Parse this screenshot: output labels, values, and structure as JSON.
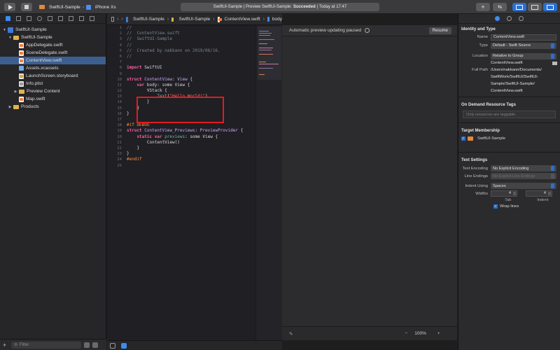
{
  "toolbar": {
    "scheme": "SwiftUI-Sample",
    "device": "iPhone Xs",
    "status_prefix": "SwiftUI-Sample | Preview SwiftUI-Sample:",
    "status_state": "Succeeded",
    "status_time": "| Today at 17:47"
  },
  "navigator": {
    "items": [
      {
        "label": "SwiftUI-Sample",
        "icon": "project-icon"
      },
      {
        "label": "SwiftUI-Sample",
        "icon": "folder-icon"
      },
      {
        "label": "AppDelegate.swift",
        "icon": "swift-file-icon"
      },
      {
        "label": "SceneDelegate.swift",
        "icon": "swift-file-icon"
      },
      {
        "label": "ContentView.swift",
        "icon": "swift-file-icon"
      },
      {
        "label": "Assets.xcassets",
        "icon": "assets-icon"
      },
      {
        "label": "LaunchScreen.storyboard",
        "icon": "storyboard-icon"
      },
      {
        "label": "Info.plist",
        "icon": "plist-icon"
      },
      {
        "label": "Preview Content",
        "icon": "folder-icon"
      },
      {
        "label": "Map.swift",
        "icon": "swift-file-icon"
      },
      {
        "label": "Products",
        "icon": "folder-icon"
      }
    ],
    "filter_placeholder": "Filter"
  },
  "jumpbar": {
    "crumbs": [
      "SwiftUI-Sample",
      "SwiftUI-Sample",
      "ContentView.swift",
      "body"
    ]
  },
  "editor": {
    "line_numbers": [
      "1",
      "2",
      "3",
      "4",
      "5",
      "6",
      "7",
      "8",
      "9",
      "10",
      "11",
      "12",
      "13",
      "14",
      "15",
      "16",
      "17",
      "18",
      "19",
      "20",
      "21",
      "22",
      "23",
      "24",
      "25"
    ],
    "lines": {
      "l1": "//",
      "l2": "//  ContentView.swift",
      "l3": "//  SwiftUI-Sample",
      "l4": "//",
      "l5": "//  Created by nakkann on 2019/08/16.",
      "l6": "//",
      "l8_kw": "import",
      "l8_rest": " SwiftUI",
      "l10_kw": "struct",
      "l10_ty": " ContentView",
      "l10_rest": ": ",
      "l10_ty2": "View",
      "l10_end": " {",
      "l11_kw": "    var",
      "l11_rest": " body: some View {",
      "l12": "        VStack {",
      "l13_fn": "            Text",
      "l13_p1": "(",
      "l13_st": "\"Hello World!\"",
      "l13_p2": ")",
      "l14": "        }",
      "l15": "    }",
      "l16": "}",
      "l18": "#if DEBUG",
      "l19_kw": "struct",
      "l19_ty": " ContentView_Previews",
      "l19_rest": ": ",
      "l19_ty2": "PreviewProvider",
      "l19_end": " {",
      "l20_kw": "    static var",
      "l20_fn": " previews",
      "l20_rest": ": some View {",
      "l21": "        ContentView()",
      "l22": "    }",
      "l23": "}",
      "l24": "#endif"
    }
  },
  "canvas": {
    "notice": "Automatic preview updating paused",
    "resume": "Resume",
    "zoom": "100%"
  },
  "inspector": {
    "identity_title": "Identity and Type",
    "name_label": "Name",
    "name_value": "ContentView.swift",
    "type_label": "Type",
    "type_value": "Default - Swift Source",
    "location_label": "Location",
    "location_value": "Relative to Group",
    "location_file": "ContentView.swift",
    "fullpath_label": "Full Path",
    "fullpath_value_1": "/Users/nakkann/Documents/",
    "fullpath_value_2": "SwiftWork/SwiftUI/SwiftUI-",
    "fullpath_value_3": "Sample/SwiftUI-Sample/",
    "fullpath_value_4": "ContentView.swift",
    "odr_title": "On Demand Resource Tags",
    "odr_placeholder": "Only resources are taggable",
    "target_title": "Target Membership",
    "target_name": "SwiftUI-Sample",
    "text_title": "Text Settings",
    "encoding_label": "Text Encoding",
    "encoding_value": "No Explicit Encoding",
    "line_endings_label": "Line Endings",
    "line_endings_value": "No Explicit Line Endings",
    "indent_label": "Indent Using",
    "indent_value": "Spaces",
    "widths_label": "Widths",
    "tab_value": "4",
    "indent_num_value": "4",
    "tab_label": "Tab",
    "indent_sub_label": "Indent",
    "wrap_label": "Wrap lines"
  },
  "colors": {
    "accent": "#2a6fd0",
    "highlight_box": "#e11b22",
    "keyword": "#fc5fa3",
    "string": "#fc6a5d"
  }
}
